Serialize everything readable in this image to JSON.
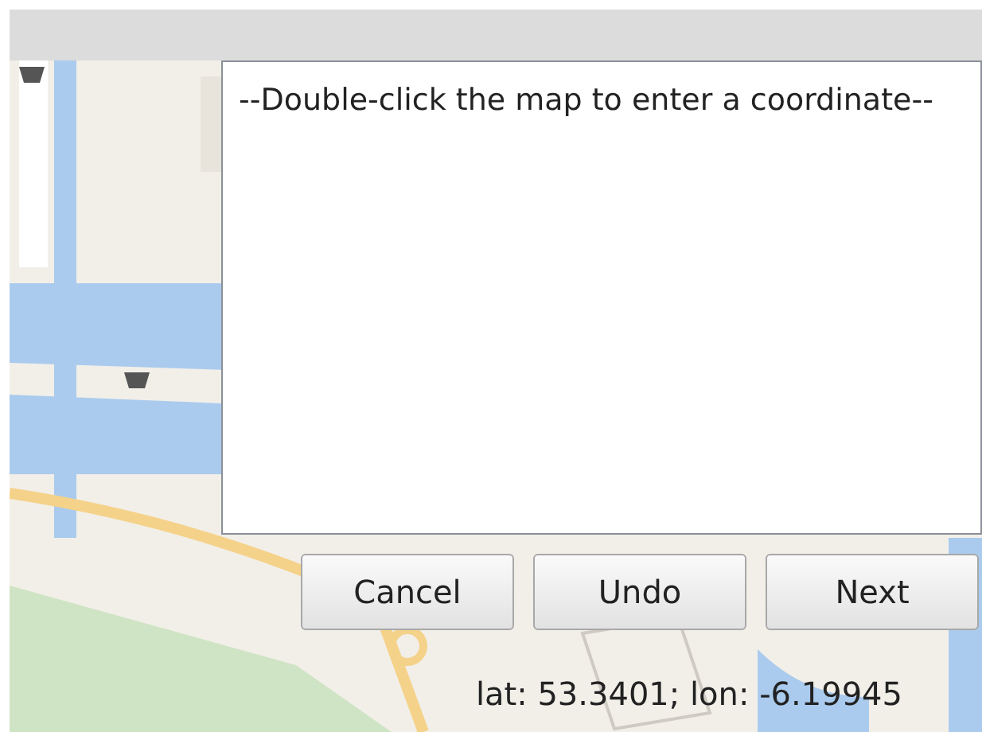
{
  "message": {
    "value": "--Double-click the map to enter a coordinate--"
  },
  "buttons": [
    "Cancel",
    "Undo",
    "Next"
  ],
  "coordinates": "lat: 53.3401; lon: -6.19945"
}
